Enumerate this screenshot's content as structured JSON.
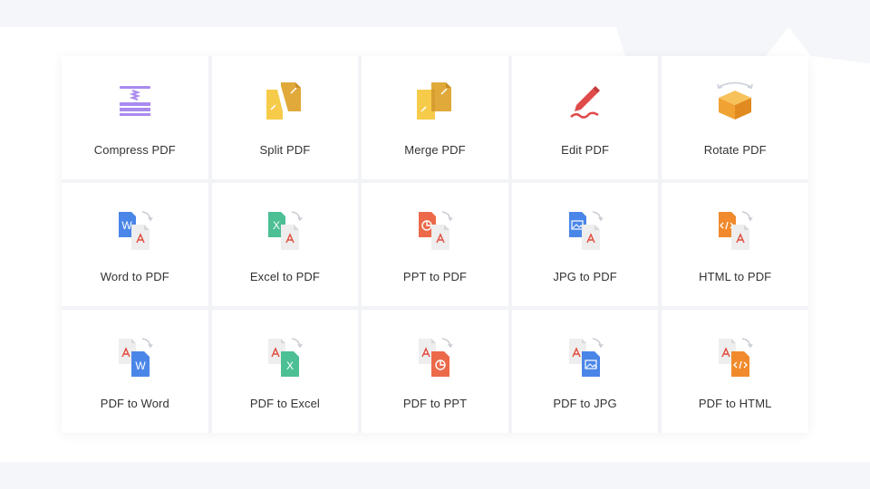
{
  "tools": [
    {
      "label": "Compress PDF",
      "icon": "compress-icon"
    },
    {
      "label": "Split PDF",
      "icon": "split-icon"
    },
    {
      "label": "Merge PDF",
      "icon": "merge-icon"
    },
    {
      "label": "Edit PDF",
      "icon": "edit-pencil-icon"
    },
    {
      "label": "Rotate PDF",
      "icon": "rotate-cube-icon"
    },
    {
      "label": "Word to PDF",
      "icon": "word-to-pdf-icon"
    },
    {
      "label": "Excel to PDF",
      "icon": "excel-to-pdf-icon"
    },
    {
      "label": "PPT to PDF",
      "icon": "ppt-to-pdf-icon"
    },
    {
      "label": "JPG to PDF",
      "icon": "jpg-to-pdf-icon"
    },
    {
      "label": "HTML to PDF",
      "icon": "html-to-pdf-icon"
    },
    {
      "label": "PDF to Word",
      "icon": "pdf-to-word-icon"
    },
    {
      "label": "PDF to Excel",
      "icon": "pdf-to-excel-icon"
    },
    {
      "label": "PDF to PPT",
      "icon": "pdf-to-ppt-icon"
    },
    {
      "label": "PDF to JPG",
      "icon": "pdf-to-jpg-icon"
    },
    {
      "label": "PDF to HTML",
      "icon": "pdf-to-html-icon"
    }
  ],
  "colors": {
    "word": "#4a86e8",
    "excel": "#4cbf94",
    "ppt": "#ec6a4a",
    "jpg": "#4a86e8",
    "html": "#f08a2c",
    "pdf_red": "#e04a3a",
    "purple": "#a98af0",
    "gold": "#f2c13c",
    "edit_red": "#e04a4a"
  }
}
